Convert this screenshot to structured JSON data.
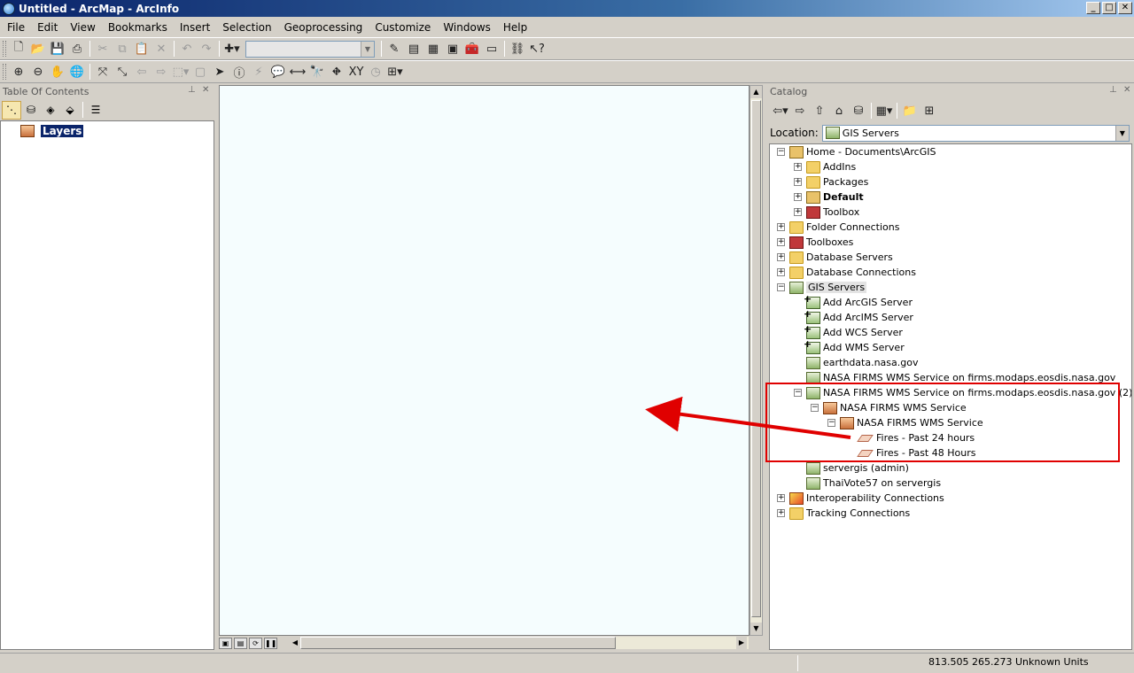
{
  "window": {
    "title": "Untitled - ArcMap - ArcInfo",
    "min": "_",
    "max": "□",
    "close": "✕"
  },
  "menu": [
    "File",
    "Edit",
    "View",
    "Bookmarks",
    "Insert",
    "Selection",
    "Geoprocessing",
    "Customize",
    "Windows",
    "Help"
  ],
  "toc": {
    "title": "Table Of Contents",
    "root_label": "Layers"
  },
  "catalog": {
    "title": "Catalog",
    "location_label": "Location:",
    "location_value": "GIS Servers",
    "tree": {
      "home": "Home - Documents\\ArcGIS",
      "addins": "AddIns",
      "packages": "Packages",
      "default": "Default",
      "toolbox": "Toolbox",
      "folder_connections": "Folder Connections",
      "toolboxes": "Toolboxes",
      "database_servers": "Database Servers",
      "database_connections": "Database Connections",
      "gis_servers": "GIS Servers",
      "add_arcgis_server": "Add ArcGIS Server",
      "add_arcims_server": "Add ArcIMS Server",
      "add_wcs_server": "Add WCS Server",
      "add_wms_server": "Add WMS Server",
      "earthdata": "earthdata.nasa.gov",
      "firms_service": "NASA FIRMS WMS Service on firms.modaps.eosdis.nasa.gov",
      "firms_service_2": "NASA FIRMS WMS Service on firms.modaps.eosdis.nasa.gov (2)",
      "firms_wms": "NASA FIRMS WMS Service",
      "firms_wms_inner": "NASA FIRMS WMS Service",
      "fires_24": "Fires - Past 24 hours",
      "fires_48": "Fires - Past 48 Hours",
      "servergis": "servergis (admin)",
      "thaivote": "ThaiVote57 on servergis",
      "interop": "Interoperability Connections",
      "tracking": "Tracking Connections"
    }
  },
  "status": {
    "coordinates": "813.505  265.273 Unknown Units"
  },
  "colors": {
    "annotation": "#e00000",
    "title_bar": "#0a246a"
  }
}
